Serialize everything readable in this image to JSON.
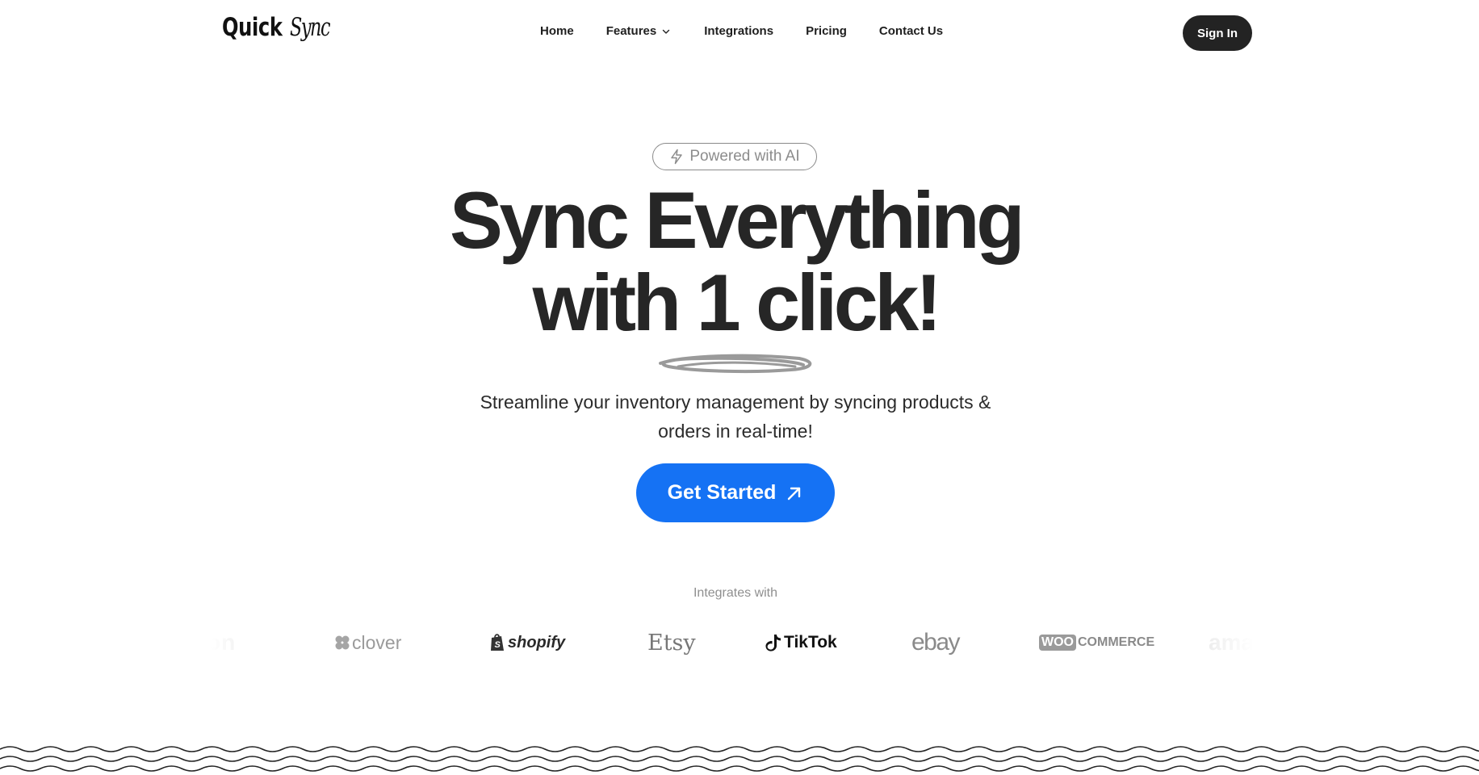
{
  "nav": {
    "logo_part1": "Quick",
    "logo_part2": "Sync",
    "links": [
      {
        "label": "Home"
      },
      {
        "label": "Features",
        "icon": "chevron-down-icon"
      },
      {
        "label": "Integrations"
      },
      {
        "label": "Pricing"
      },
      {
        "label": "Contact Us"
      }
    ],
    "signin_label": "Sign In"
  },
  "hero": {
    "badge_icon": "lightning-icon",
    "badge_label": "Powered with AI",
    "headline_line1": "Sync Everything",
    "headline_line2": "with 1 click!",
    "subtitle": "Streamline your inventory management by syncing products & orders in real-time!",
    "cta_label": "Get Started",
    "cta_icon": "arrow-up-right-icon"
  },
  "integrations": {
    "heading": "Integrates with",
    "brands": [
      {
        "name": "amazon",
        "text": "on"
      },
      {
        "name": "clover",
        "text": "clover"
      },
      {
        "name": "shopify",
        "text": "shopify"
      },
      {
        "name": "etsy",
        "text": "Etsy"
      },
      {
        "name": "tiktok",
        "text": "TikTok"
      },
      {
        "name": "ebay",
        "text": "ebay"
      },
      {
        "name": "woocommerce",
        "text_box": "WOO",
        "text": "COMMERCE"
      },
      {
        "name": "amazon",
        "text": "ama"
      }
    ]
  },
  "colors": {
    "primary": "#1572f4",
    "dark": "#232323",
    "text": "#262626",
    "muted": "#8f8f8f"
  }
}
